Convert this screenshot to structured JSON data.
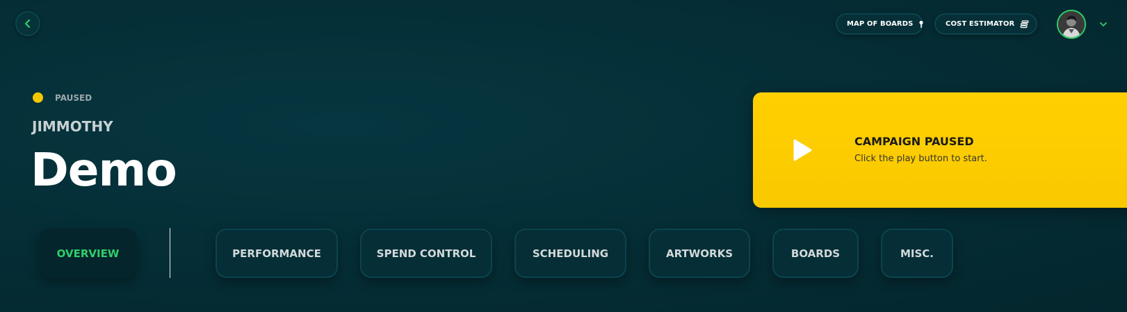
{
  "header": {
    "back_icon": "chevron-left-icon",
    "map_of_boards": {
      "label": "MAP OF BOARDS",
      "icon": "pin-icon"
    },
    "cost_estimator": {
      "label": "COST ESTIMATOR",
      "icon": "coins-icon"
    },
    "avatar": "user-avatar",
    "menu_icon": "chevron-down-icon"
  },
  "campaign": {
    "status": "PAUSED",
    "client": "JIMMOTHY",
    "title": "Demo"
  },
  "paused_card": {
    "heading": "CAMPAIGN PAUSED",
    "subtext": "Click the play button to start.",
    "play_icon": "play-icon"
  },
  "tabs": [
    {
      "label": "OVERVIEW",
      "active": true
    },
    {
      "label": "PERFORMANCE",
      "active": false
    },
    {
      "label": "SPEND CONTROL",
      "active": false
    },
    {
      "label": "SCHEDULING",
      "active": false
    },
    {
      "label": "ARTWORKS",
      "active": false
    },
    {
      "label": "BOARDS",
      "active": false
    },
    {
      "label": "MISC.",
      "active": false
    }
  ],
  "colors": {
    "background": "#052b33",
    "accent_green": "#2fd06a",
    "status_yellow": "#f6c700",
    "card_yellow": "#ffd000"
  }
}
